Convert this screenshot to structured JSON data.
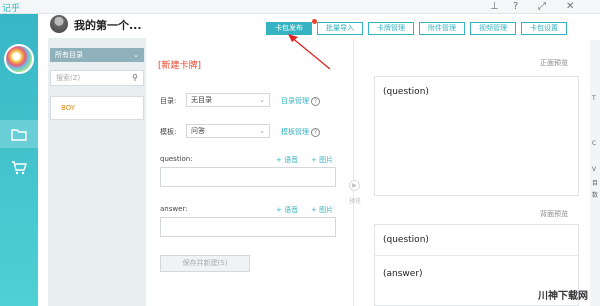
{
  "app": {
    "logo": "记乎"
  },
  "window_controls": {
    "pin": "📌",
    "help": "?",
    "expand": "⤢",
    "close": "×"
  },
  "deck": {
    "title": "我的第一个..."
  },
  "toolbar": {
    "buttons": [
      "卡包发布",
      "批量导入",
      "卡牌管理",
      "附件管理",
      "视频管理",
      "卡包设置"
    ]
  },
  "catalog": {
    "all_dirs": "所有目录",
    "search_placeholder": "搜索(Z)",
    "items": [
      "BOY"
    ]
  },
  "editor": {
    "new_card": "[新建卡牌]",
    "dir_label": "目录:",
    "dir_value": "无目录",
    "dir_manage": "目录管理",
    "template_label": "模板:",
    "template_value": "问答",
    "template_manage": "模板管理",
    "question_label": "question:",
    "answer_label": "answer:",
    "add_voice": "+ 语音",
    "add_image": "+ 图片",
    "save_new": "保存并新建(S)"
  },
  "preview": {
    "toggle_label": "预览",
    "front_title": "正面预览",
    "back_title": "背面预览",
    "front_question": "(question)",
    "back_question": "(question)",
    "back_answer": "(answer)"
  },
  "right_strip": {
    "texts": [
      "T",
      "C",
      "V",
      "目",
      "数"
    ]
  },
  "watermark": "川神下载网"
}
